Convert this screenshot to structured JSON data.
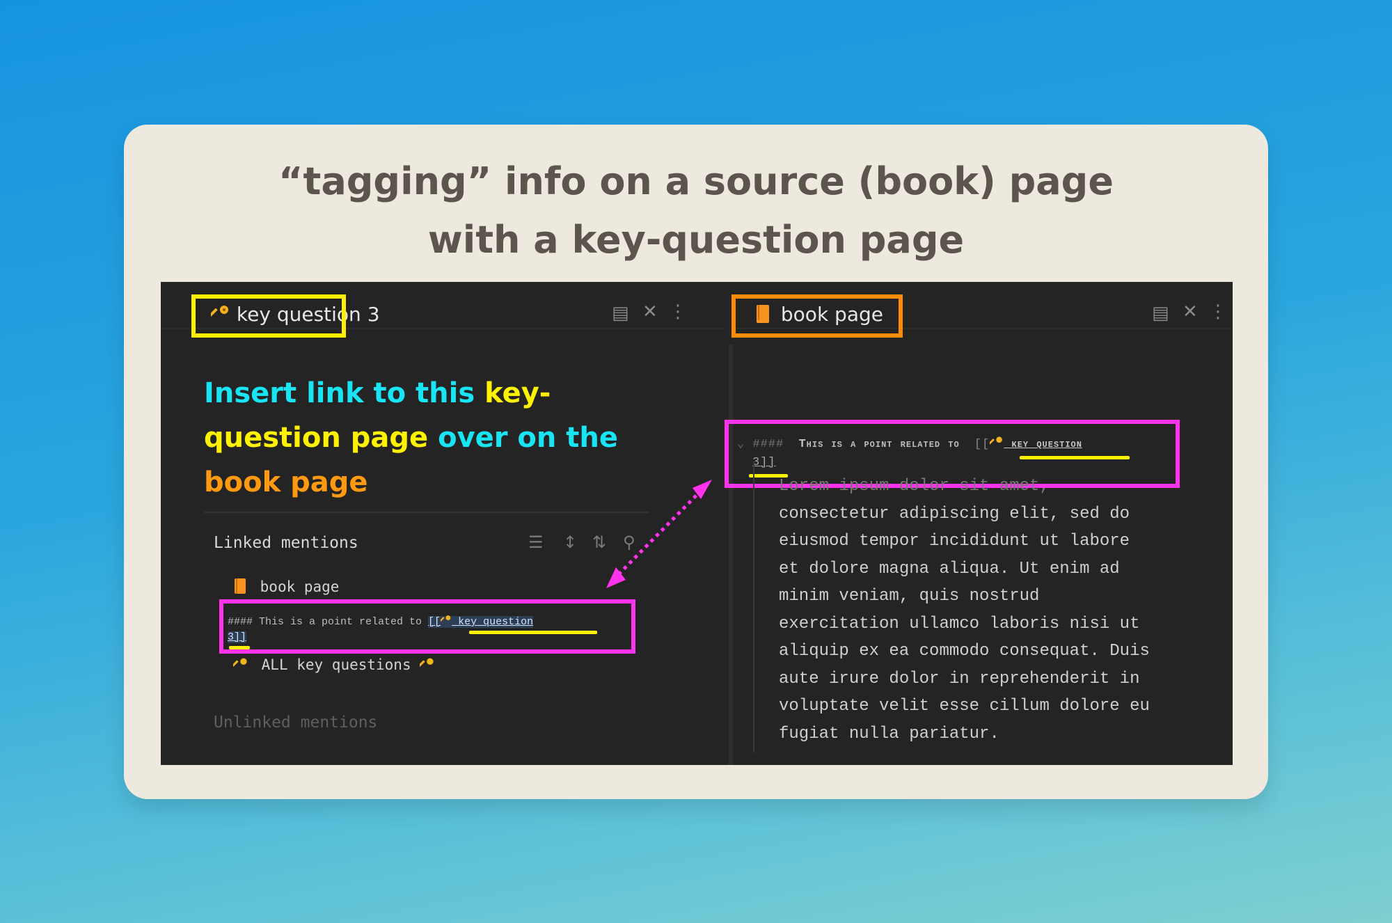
{
  "headline": {
    "line1": "“tagging” info on a source (book) page",
    "line2": "with a key-question page"
  },
  "left_pane": {
    "title": "key question 3",
    "icon": "key-icon",
    "callout": {
      "part1": "Insert link to this ",
      "part2": "key-question page",
      "part3": " over on the",
      "part4": "book page"
    },
    "linked_mentions_label": "Linked mentions",
    "mention_page": "book page",
    "snippet": {
      "prefix": "#### This is a point related to ",
      "link_open": "[[",
      "link_text": " key question",
      "link_close": "3]]"
    },
    "all_key_questions": "ALL key questions",
    "unlinked_mentions_label": "Unlinked mentions"
  },
  "right_pane": {
    "title": "book page",
    "icon": "book-icon",
    "heading": {
      "hashes": "####",
      "text": "This is a point related to",
      "link_open": "[[",
      "link_text": " key question",
      "link_close": "3]]"
    },
    "body_lines": [
      "Lorem ipsum dolor sit amet,",
      "consectetur adipiscing elit, sed do",
      "eiusmod tempor incididunt ut labore",
      "et dolore magna aliqua. Ut enim ad",
      "minim veniam, quis nostrud",
      "exercitation ullamco laboris nisi ut",
      "aliquip ex ea commodo consequat. Duis",
      "aute irure dolor in reprehenderit in",
      "voluptate velit esse cillum dolore eu",
      "fugiat nulla pariatur."
    ]
  },
  "colors": {
    "highlight_yellow": "#fff200",
    "highlight_orange": "#ff8c00",
    "highlight_pink": "#ff33ee",
    "callout_cyan": "#19e4f4",
    "editor_bg": "#242424"
  }
}
